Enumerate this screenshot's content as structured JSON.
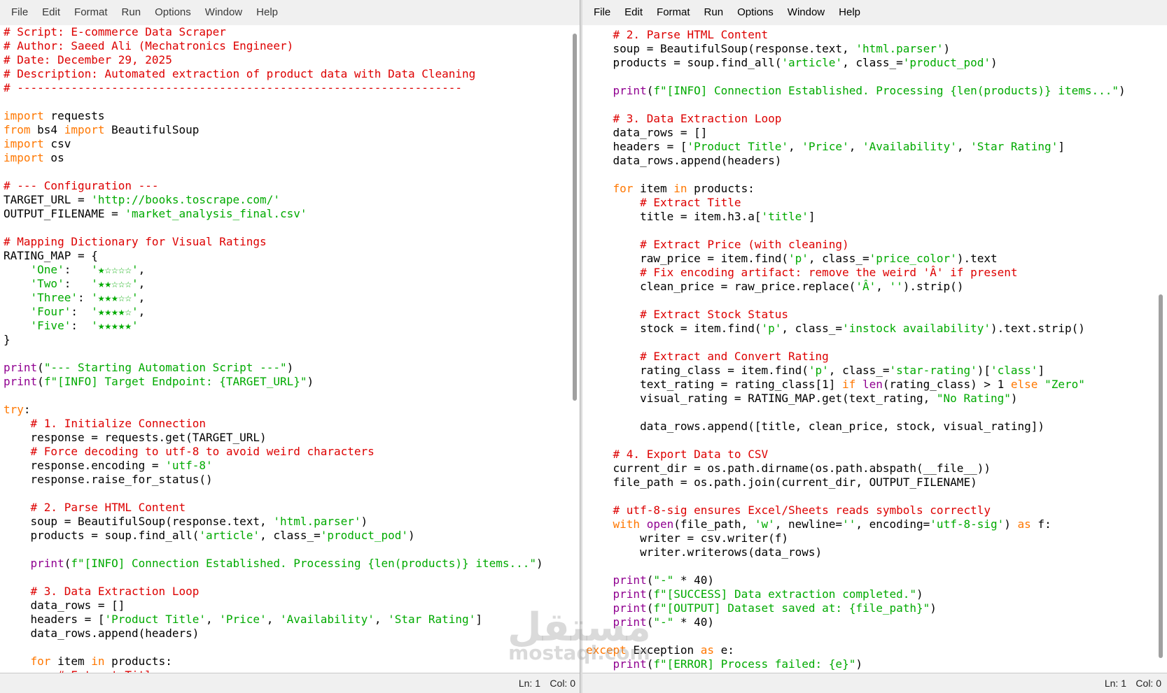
{
  "menus": [
    "File",
    "Edit",
    "Format",
    "Run",
    "Options",
    "Window",
    "Help"
  ],
  "left_pane": {
    "status": {
      "ln": "Ln: 1",
      "col": "Col: 0"
    },
    "lines": [
      [
        [
          "# Script: E-commerce Data Scraper",
          "comment"
        ]
      ],
      [
        [
          "# Author: Saeed Ali (Mechatronics Engineer)",
          "comment"
        ]
      ],
      [
        [
          "# Date: December 29, 2025",
          "comment"
        ]
      ],
      [
        [
          "# Description: Automated extraction of product data with Data Cleaning",
          "comment"
        ]
      ],
      [
        [
          "# ------------------------------------------------------------------",
          "comment"
        ]
      ],
      [],
      [
        [
          "import",
          "keyword"
        ],
        [
          " requests",
          "plain"
        ]
      ],
      [
        [
          "from",
          "keyword"
        ],
        [
          " bs4 ",
          "plain"
        ],
        [
          "import",
          "keyword"
        ],
        [
          " BeautifulSoup",
          "plain"
        ]
      ],
      [
        [
          "import",
          "keyword"
        ],
        [
          " csv",
          "plain"
        ]
      ],
      [
        [
          "import",
          "keyword"
        ],
        [
          " os",
          "plain"
        ]
      ],
      [],
      [
        [
          "# --- Configuration ---",
          "comment"
        ]
      ],
      [
        [
          "TARGET_URL = ",
          "plain"
        ],
        [
          "'http://books.toscrape.com/'",
          "string"
        ]
      ],
      [
        [
          "OUTPUT_FILENAME = ",
          "plain"
        ],
        [
          "'market_analysis_final.csv'",
          "string"
        ]
      ],
      [],
      [
        [
          "# Mapping Dictionary for Visual Ratings",
          "comment"
        ]
      ],
      [
        [
          "RATING_MAP = {",
          "plain"
        ]
      ],
      [
        [
          "    ",
          "plain"
        ],
        [
          "'One'",
          "string"
        ],
        [
          ":   ",
          "plain"
        ],
        [
          "'★☆☆☆☆'",
          "string"
        ],
        [
          ",",
          "plain"
        ]
      ],
      [
        [
          "    ",
          "plain"
        ],
        [
          "'Two'",
          "string"
        ],
        [
          ":   ",
          "plain"
        ],
        [
          "'★★☆☆☆'",
          "string"
        ],
        [
          ",",
          "plain"
        ]
      ],
      [
        [
          "    ",
          "plain"
        ],
        [
          "'Three'",
          "string"
        ],
        [
          ": ",
          "plain"
        ],
        [
          "'★★★☆☆'",
          "string"
        ],
        [
          ",",
          "plain"
        ]
      ],
      [
        [
          "    ",
          "plain"
        ],
        [
          "'Four'",
          "string"
        ],
        [
          ":  ",
          "plain"
        ],
        [
          "'★★★★☆'",
          "string"
        ],
        [
          ",",
          "plain"
        ]
      ],
      [
        [
          "    ",
          "plain"
        ],
        [
          "'Five'",
          "string"
        ],
        [
          ":  ",
          "plain"
        ],
        [
          "'★★★★★'",
          "string"
        ]
      ],
      [
        [
          "}",
          "plain"
        ]
      ],
      [],
      [
        [
          "print",
          "builtin"
        ],
        [
          "(",
          "plain"
        ],
        [
          "\"--- Starting Automation Script ---\"",
          "string"
        ],
        [
          ")",
          "plain"
        ]
      ],
      [
        [
          "print",
          "builtin"
        ],
        [
          "(",
          "plain"
        ],
        [
          "f\"[INFO] Target Endpoint: {TARGET_URL}\"",
          "string"
        ],
        [
          ")",
          "plain"
        ]
      ],
      [],
      [
        [
          "try",
          "keyword"
        ],
        [
          ":",
          "plain"
        ]
      ],
      [
        [
          "    ",
          "plain"
        ],
        [
          "# 1. Initialize Connection",
          "comment"
        ]
      ],
      [
        [
          "    response = requests.get(TARGET_URL)",
          "plain"
        ]
      ],
      [
        [
          "    ",
          "plain"
        ],
        [
          "# Force decoding to utf-8 to avoid weird characters",
          "comment"
        ]
      ],
      [
        [
          "    response.encoding = ",
          "plain"
        ],
        [
          "'utf-8'",
          "string"
        ]
      ],
      [
        [
          "    response.raise_for_status()",
          "plain"
        ]
      ],
      [],
      [
        [
          "    ",
          "plain"
        ],
        [
          "# 2. Parse HTML Content",
          "comment"
        ]
      ],
      [
        [
          "    soup = BeautifulSoup(response.text, ",
          "plain"
        ],
        [
          "'html.parser'",
          "string"
        ],
        [
          ")",
          "plain"
        ]
      ],
      [
        [
          "    products = soup.find_all(",
          "plain"
        ],
        [
          "'article'",
          "string"
        ],
        [
          ", class_=",
          "plain"
        ],
        [
          "'product_pod'",
          "string"
        ],
        [
          ")",
          "plain"
        ]
      ],
      [],
      [
        [
          "    ",
          "plain"
        ],
        [
          "print",
          "builtin"
        ],
        [
          "(",
          "plain"
        ],
        [
          "f\"[INFO] Connection Established. Processing {len(products)} items...\"",
          "string"
        ],
        [
          ")",
          "plain"
        ]
      ],
      [],
      [
        [
          "    ",
          "plain"
        ],
        [
          "# 3. Data Extraction Loop",
          "comment"
        ]
      ],
      [
        [
          "    data_rows = []",
          "plain"
        ]
      ],
      [
        [
          "    headers = [",
          "plain"
        ],
        [
          "'Product Title'",
          "string"
        ],
        [
          ", ",
          "plain"
        ],
        [
          "'Price'",
          "string"
        ],
        [
          ", ",
          "plain"
        ],
        [
          "'Availability'",
          "string"
        ],
        [
          ", ",
          "plain"
        ],
        [
          "'Star Rating'",
          "string"
        ],
        [
          "]",
          "plain"
        ]
      ],
      [
        [
          "    data_rows.append(headers)",
          "plain"
        ]
      ],
      [],
      [
        [
          "    ",
          "plain"
        ],
        [
          "for",
          "keyword"
        ],
        [
          " item ",
          "plain"
        ],
        [
          "in",
          "keyword"
        ],
        [
          " products:",
          "plain"
        ]
      ],
      [
        [
          "        ",
          "plain"
        ],
        [
          "# Extract Title",
          "comment"
        ]
      ]
    ]
  },
  "right_pane": {
    "status": {
      "ln": "Ln: 1",
      "col": "Col: 0"
    },
    "lines": [
      [
        [
          "    ",
          "plain"
        ],
        [
          "# 2. Parse HTML Content",
          "comment"
        ]
      ],
      [
        [
          "    soup = BeautifulSoup(response.text, ",
          "plain"
        ],
        [
          "'html.parser'",
          "string"
        ],
        [
          ")",
          "plain"
        ]
      ],
      [
        [
          "    products = soup.find_all(",
          "plain"
        ],
        [
          "'article'",
          "string"
        ],
        [
          ", class_=",
          "plain"
        ],
        [
          "'product_pod'",
          "string"
        ],
        [
          ")",
          "plain"
        ]
      ],
      [],
      [
        [
          "    ",
          "plain"
        ],
        [
          "print",
          "builtin"
        ],
        [
          "(",
          "plain"
        ],
        [
          "f\"[INFO] Connection Established. Processing {len(products)} items...\"",
          "string"
        ],
        [
          ")",
          "plain"
        ]
      ],
      [],
      [
        [
          "    ",
          "plain"
        ],
        [
          "# 3. Data Extraction Loop",
          "comment"
        ]
      ],
      [
        [
          "    data_rows = []",
          "plain"
        ]
      ],
      [
        [
          "    headers = [",
          "plain"
        ],
        [
          "'Product Title'",
          "string"
        ],
        [
          ", ",
          "plain"
        ],
        [
          "'Price'",
          "string"
        ],
        [
          ", ",
          "plain"
        ],
        [
          "'Availability'",
          "string"
        ],
        [
          ", ",
          "plain"
        ],
        [
          "'Star Rating'",
          "string"
        ],
        [
          "]",
          "plain"
        ]
      ],
      [
        [
          "    data_rows.append(headers)",
          "plain"
        ]
      ],
      [],
      [
        [
          "    ",
          "plain"
        ],
        [
          "for",
          "keyword"
        ],
        [
          " item ",
          "plain"
        ],
        [
          "in",
          "keyword"
        ],
        [
          " products:",
          "plain"
        ]
      ],
      [
        [
          "        ",
          "plain"
        ],
        [
          "# Extract Title",
          "comment"
        ]
      ],
      [
        [
          "        title = item.h3.a[",
          "plain"
        ],
        [
          "'title'",
          "string"
        ],
        [
          "]",
          "plain"
        ]
      ],
      [],
      [
        [
          "        ",
          "plain"
        ],
        [
          "# Extract Price (with cleaning)",
          "comment"
        ]
      ],
      [
        [
          "        raw_price = item.find(",
          "plain"
        ],
        [
          "'p'",
          "string"
        ],
        [
          ", class_=",
          "plain"
        ],
        [
          "'price_color'",
          "string"
        ],
        [
          ").text",
          "plain"
        ]
      ],
      [
        [
          "        ",
          "plain"
        ],
        [
          "# Fix encoding artifact: remove the weird 'Â' if present",
          "comment"
        ]
      ],
      [
        [
          "        clean_price = raw_price.replace(",
          "plain"
        ],
        [
          "'Â'",
          "string"
        ],
        [
          ", ",
          "plain"
        ],
        [
          "''",
          "string"
        ],
        [
          ").strip()",
          "plain"
        ]
      ],
      [],
      [
        [
          "        ",
          "plain"
        ],
        [
          "# Extract Stock Status",
          "comment"
        ]
      ],
      [
        [
          "        stock = item.find(",
          "plain"
        ],
        [
          "'p'",
          "string"
        ],
        [
          ", class_=",
          "plain"
        ],
        [
          "'instock availability'",
          "string"
        ],
        [
          ").text.strip()",
          "plain"
        ]
      ],
      [],
      [
        [
          "        ",
          "plain"
        ],
        [
          "# Extract and Convert Rating",
          "comment"
        ]
      ],
      [
        [
          "        rating_class = item.find(",
          "plain"
        ],
        [
          "'p'",
          "string"
        ],
        [
          ", class_=",
          "plain"
        ],
        [
          "'star-rating'",
          "string"
        ],
        [
          ")[",
          "plain"
        ],
        [
          "'class'",
          "string"
        ],
        [
          "]",
          "plain"
        ]
      ],
      [
        [
          "        text_rating = rating_class[1] ",
          "plain"
        ],
        [
          "if",
          "keyword"
        ],
        [
          " ",
          "plain"
        ],
        [
          "len",
          "builtin"
        ],
        [
          "(rating_class) > 1 ",
          "plain"
        ],
        [
          "else",
          "keyword"
        ],
        [
          " ",
          "plain"
        ],
        [
          "\"Zero\"",
          "string"
        ]
      ],
      [
        [
          "        visual_rating = RATING_MAP.get(text_rating, ",
          "plain"
        ],
        [
          "\"No Rating\"",
          "string"
        ],
        [
          ")",
          "plain"
        ]
      ],
      [],
      [
        [
          "        data_rows.append([title, clean_price, stock, visual_rating])",
          "plain"
        ]
      ],
      [],
      [
        [
          "    ",
          "plain"
        ],
        [
          "# 4. Export Data to CSV",
          "comment"
        ]
      ],
      [
        [
          "    current_dir = os.path.dirname(os.path.abspath(__file__))",
          "plain"
        ]
      ],
      [
        [
          "    file_path = os.path.join(current_dir, OUTPUT_FILENAME)",
          "plain"
        ]
      ],
      [],
      [
        [
          "    ",
          "plain"
        ],
        [
          "# utf-8-sig ensures Excel/Sheets reads symbols correctly",
          "comment"
        ]
      ],
      [
        [
          "    ",
          "plain"
        ],
        [
          "with",
          "keyword"
        ],
        [
          " ",
          "plain"
        ],
        [
          "open",
          "builtin"
        ],
        [
          "(file_path, ",
          "plain"
        ],
        [
          "'w'",
          "string"
        ],
        [
          ", newline=",
          "plain"
        ],
        [
          "''",
          "string"
        ],
        [
          ", encoding=",
          "plain"
        ],
        [
          "'utf-8-sig'",
          "string"
        ],
        [
          ") ",
          "plain"
        ],
        [
          "as",
          "keyword"
        ],
        [
          " f:",
          "plain"
        ]
      ],
      [
        [
          "        writer = csv.writer(f)",
          "plain"
        ]
      ],
      [
        [
          "        writer.writerows(data_rows)",
          "plain"
        ]
      ],
      [],
      [
        [
          "    ",
          "plain"
        ],
        [
          "print",
          "builtin"
        ],
        [
          "(",
          "plain"
        ],
        [
          "\"-\"",
          "string"
        ],
        [
          " * 40)",
          "plain"
        ]
      ],
      [
        [
          "    ",
          "plain"
        ],
        [
          "print",
          "builtin"
        ],
        [
          "(",
          "plain"
        ],
        [
          "f\"[SUCCESS] Data extraction completed.\"",
          "string"
        ],
        [
          ")",
          "plain"
        ]
      ],
      [
        [
          "    ",
          "plain"
        ],
        [
          "print",
          "builtin"
        ],
        [
          "(",
          "plain"
        ],
        [
          "f\"[OUTPUT] Dataset saved at: {file_path}\"",
          "string"
        ],
        [
          ")",
          "plain"
        ]
      ],
      [
        [
          "    ",
          "plain"
        ],
        [
          "print",
          "builtin"
        ],
        [
          "(",
          "plain"
        ],
        [
          "\"-\"",
          "string"
        ],
        [
          " * 40)",
          "plain"
        ]
      ],
      [],
      [
        [
          "except",
          "keyword"
        ],
        [
          " Exception ",
          "plain"
        ],
        [
          "as",
          "keyword"
        ],
        [
          " e:",
          "plain"
        ]
      ],
      [
        [
          "    ",
          "plain"
        ],
        [
          "print",
          "builtin"
        ],
        [
          "(",
          "plain"
        ],
        [
          "f\"[ERROR] Process failed: {e}\"",
          "string"
        ],
        [
          ")",
          "plain"
        ]
      ]
    ]
  },
  "watermark": {
    "arabic": "مستقل",
    "latin": "mostaql.com"
  }
}
